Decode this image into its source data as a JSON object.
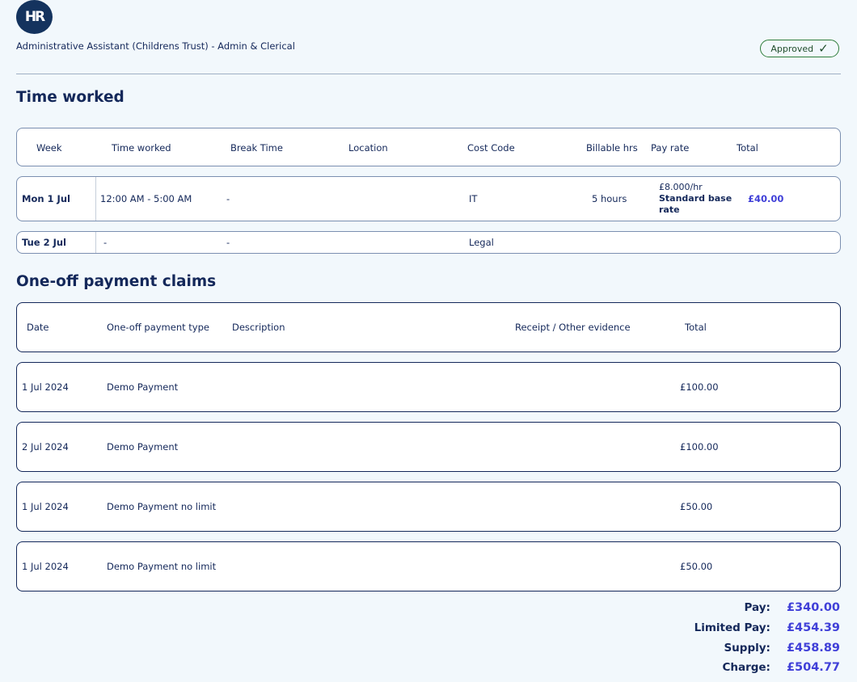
{
  "logo": {
    "text": "HR"
  },
  "job": {
    "title": "Administrative Assistant (Childrens Trust) - Admin & Clerical"
  },
  "status": {
    "label": "Approved",
    "check": "✓"
  },
  "time_section": {
    "title": "Time worked",
    "headers": {
      "week": "Week",
      "time_worked": "Time worked",
      "break_time": "Break Time",
      "location": "Location",
      "cost_code": "Cost Code",
      "billable_hrs": "Billable hrs",
      "pay_rate": "Pay rate",
      "total": "Total"
    },
    "rows": [
      {
        "week": "Mon 1 Jul",
        "time_worked": "12:00 AM - 5:00 AM",
        "break_time": "-",
        "location": "",
        "cost_code": "IT",
        "billable_hrs": "5 hours",
        "pay_rate_value": "£8.000/hr",
        "pay_rate_name_1": "Standard base",
        "pay_rate_name_2": "rate",
        "total": "£40.00"
      },
      {
        "week": "Tue 2 Jul",
        "time_worked": "-",
        "break_time": "-",
        "location": "",
        "cost_code": "Legal"
      }
    ]
  },
  "payments_section": {
    "title": "One-off payment claims",
    "headers": {
      "date": "Date",
      "type": "One-off payment type",
      "description": "Description",
      "receipt": "Receipt / Other evidence",
      "total": "Total"
    },
    "rows": [
      {
        "date": "1 Jul 2024",
        "type": "Demo Payment",
        "total": "£100.00"
      },
      {
        "date": "2 Jul 2024",
        "type": "Demo Payment",
        "total": "£100.00"
      },
      {
        "date": "1 Jul 2024",
        "type": "Demo Payment no limit",
        "total": "£50.00"
      },
      {
        "date": "1 Jul 2024",
        "type": "Demo Payment no limit",
        "total": "£50.00"
      }
    ]
  },
  "totals": {
    "pay_label": "Pay:",
    "pay_value": "£340.00",
    "limited_pay_label": "Limited Pay:",
    "limited_pay_value": "£454.39",
    "supply_label": "Supply:",
    "supply_value": "£458.89",
    "charge_label": "Charge:",
    "charge_value": "£504.77"
  },
  "colors": {
    "accent": "#4040d8",
    "navy": "#14285a",
    "approved": "#2e7d3a",
    "background": "#f2f8fc"
  }
}
